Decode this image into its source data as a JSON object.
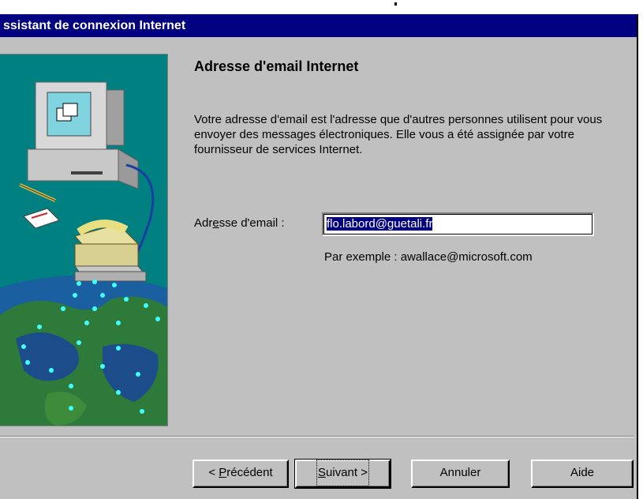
{
  "window": {
    "title": "ssistant de connexion Internet"
  },
  "page": {
    "heading": "Adresse d'email Internet",
    "description": "Votre adresse d'email est l'adresse que d'autres personnes utilisent pour vous envoyer des messages électroniques. Elle vous a été assignée par votre fournisseur de services Internet.",
    "field_label_pre": "Adr",
    "field_label_hotkey": "e",
    "field_label_post": "sse d'email :",
    "email_value": "flo.labord@guetali.fr",
    "example": "Par exemple : awallace@microsoft.com"
  },
  "buttons": {
    "back_pre": "< ",
    "back_hotkey": "P",
    "back_post": "récédent",
    "next_hotkey": "S",
    "next_post": "uivant >",
    "cancel": "Annuler",
    "help": "Aide"
  },
  "colors": {
    "titlebar": "#000080",
    "dialog_bg": "#c0c0c0",
    "illustration_bg": "#008080"
  },
  "icons": {
    "illustration": "computer-phone-globe-illustration"
  }
}
